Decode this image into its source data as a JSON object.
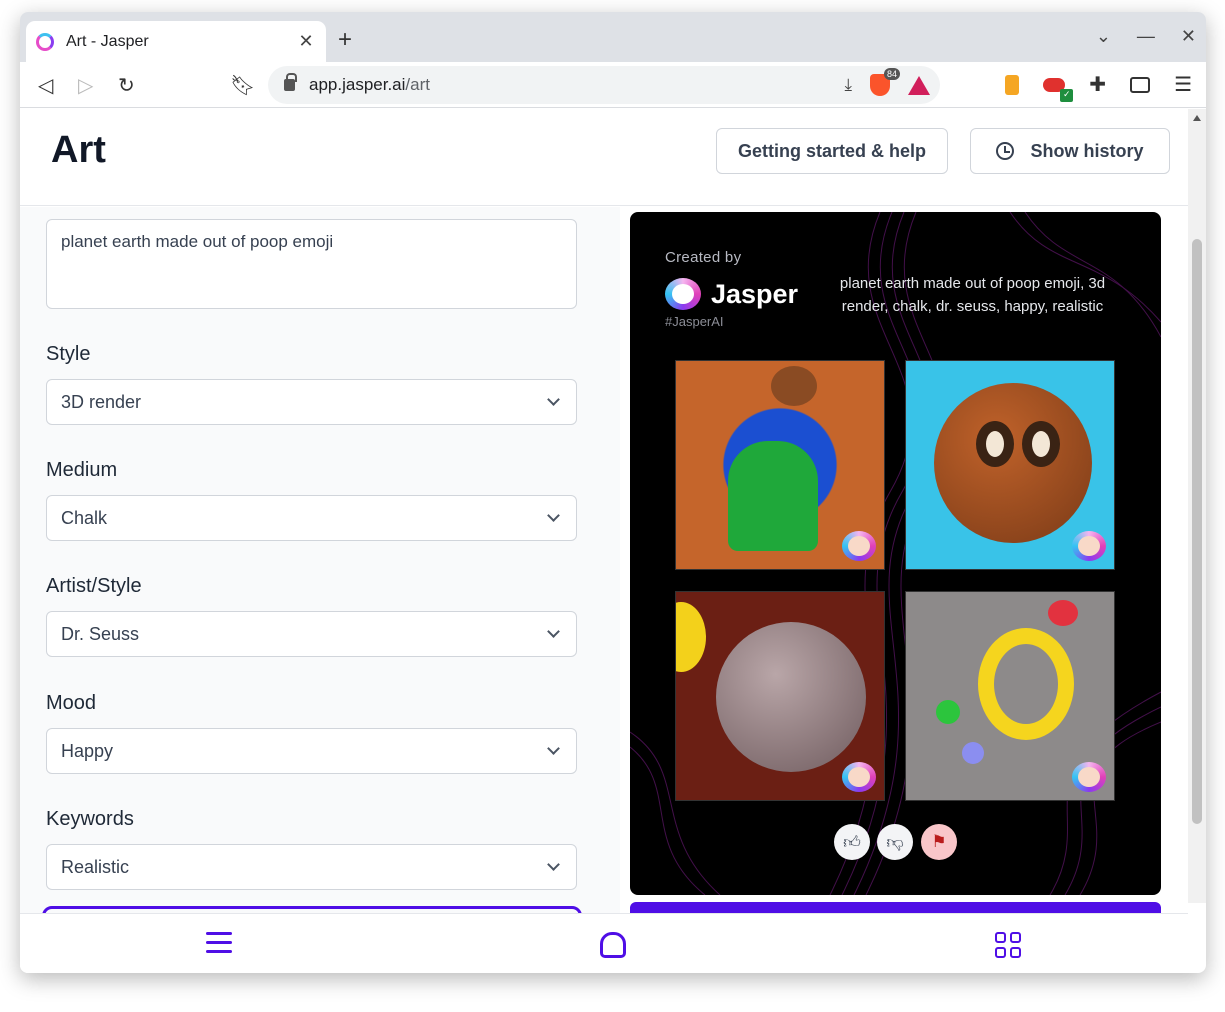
{
  "browser": {
    "tab_title": "Art - Jasper",
    "tab_close": "✕",
    "new_tab": "+",
    "url_host": "app.jasper.ai",
    "url_path": "/art",
    "brave_badge_count": "84"
  },
  "header": {
    "title": "Art",
    "help_button": "Getting started & help",
    "history_button": "Show history"
  },
  "form": {
    "prompt": "planet earth made out of poop emoji",
    "fields": [
      {
        "label": "Style",
        "value": "3D render"
      },
      {
        "label": "Medium",
        "value": "Chalk"
      },
      {
        "label": "Artist/Style",
        "value": "Dr. Seuss"
      },
      {
        "label": "Mood",
        "value": "Happy"
      },
      {
        "label": "Keywords",
        "value": "Realistic"
      }
    ]
  },
  "result": {
    "created_by": "Created by",
    "brand": "Jasper",
    "hashtag": "#JasperAI",
    "caption": "planet earth made out of poop emoji, 3d render, chalk, dr. seuss, happy, realistic",
    "feedback": [
      "thumbs-up-icon",
      "thumbs-down-icon",
      "flag-icon"
    ]
  },
  "colors": {
    "accent": "#4f0ee6",
    "panel_bg": "#000000"
  }
}
